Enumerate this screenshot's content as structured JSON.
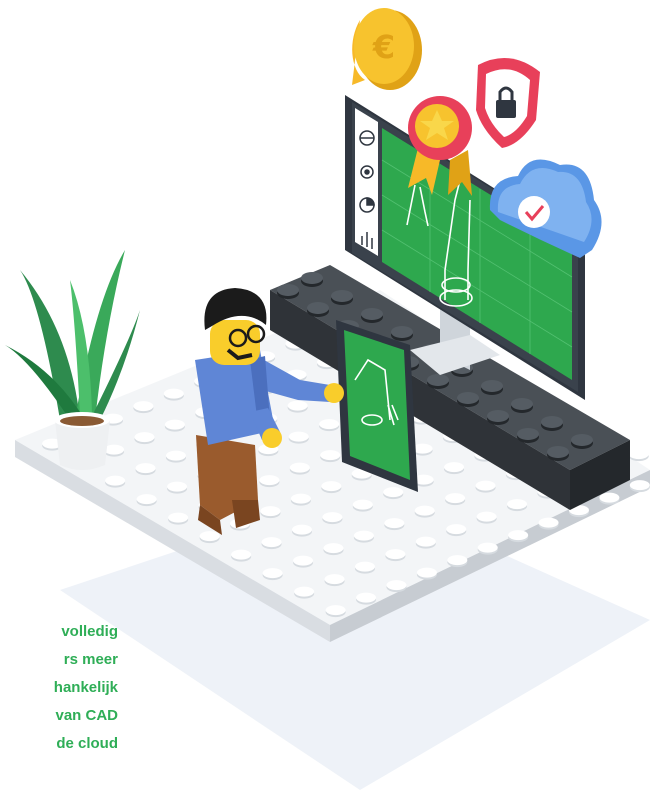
{
  "illustration": {
    "currency_symbol": "€",
    "colors": {
      "accent_green": "#2fae57",
      "screen_green": "#2ea84e",
      "monitor_dark": "#2f3640",
      "brick_dark": "#3a3f44",
      "baseplate": "#f2f4f6",
      "coin_gold": "#f7b928",
      "badge_red": "#e8405a",
      "cloud_blue": "#5a97e6",
      "shirt_blue": "#5f86d6",
      "pants_brown": "#9a5b2d",
      "skin_yellow": "#f9cd2b"
    },
    "icons": [
      "globe-icon",
      "gears-icon",
      "pie-chart-icon",
      "bar-chart-icon",
      "euro-coin-icon",
      "award-ribbon-icon",
      "lock-shield-icon",
      "cloud-check-icon"
    ]
  },
  "side_text": {
    "lines": [
      "volledig",
      "rs meer",
      "hankelijk",
      "van CAD",
      "de cloud"
    ]
  }
}
